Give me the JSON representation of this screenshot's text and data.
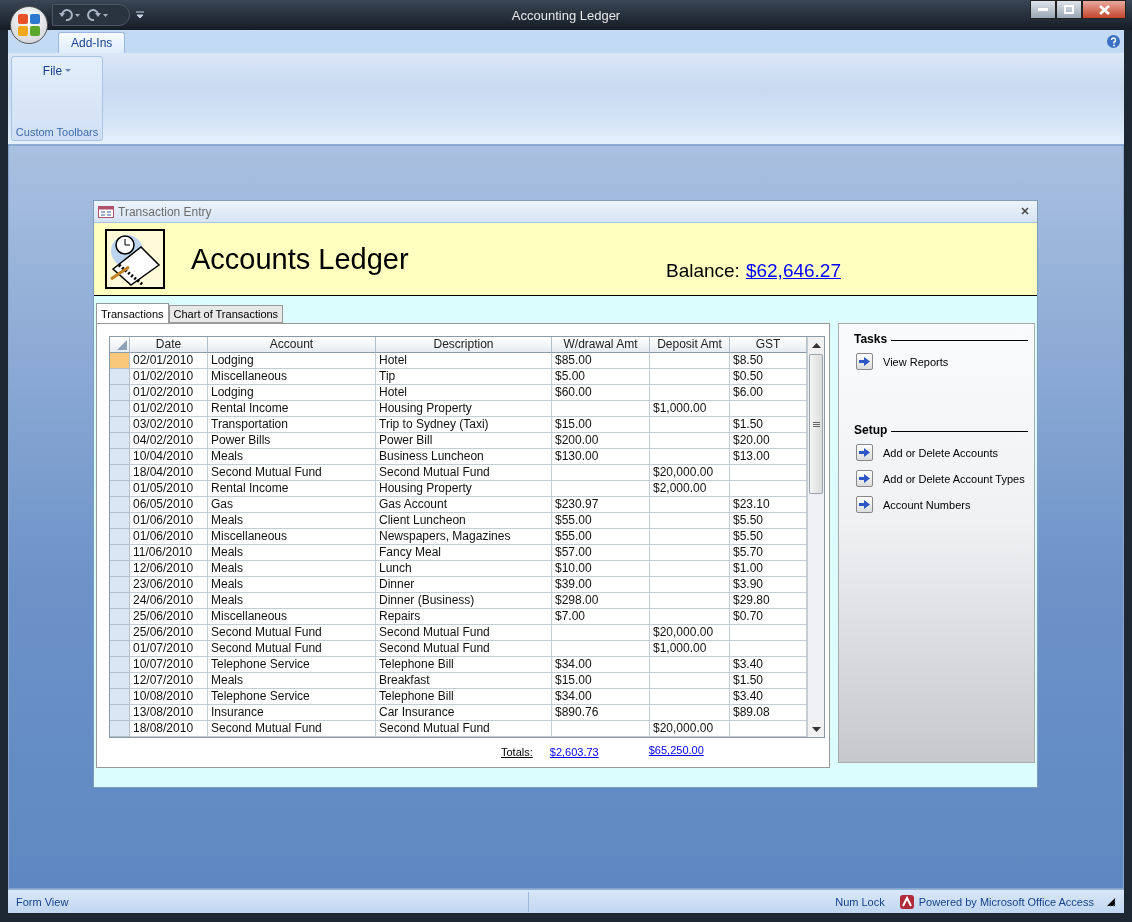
{
  "window": {
    "title": "Accounting Ledger"
  },
  "ribbon": {
    "tabs": [
      {
        "label": "Add-Ins",
        "selected": true
      }
    ],
    "groups": [
      {
        "label": "Custom Toolbars",
        "buttons": [
          "File"
        ]
      }
    ]
  },
  "form": {
    "title": "Transaction Entry",
    "heading": "Accounts Ledger",
    "balance_label": "Balance:",
    "balance_value": "$62,646.27",
    "tabs": [
      {
        "label": "Transactions",
        "selected": true
      },
      {
        "label": "Chart of Transactions",
        "selected": false
      }
    ],
    "table": {
      "columns": [
        "Date",
        "Account",
        "Description",
        "W/drawal Amt",
        "Deposit Amt",
        "GST"
      ],
      "rows": [
        {
          "selected": true,
          "cells": [
            "02/01/2010",
            "Lodging",
            "Hotel",
            "$85.00",
            "",
            "$8.50"
          ]
        },
        {
          "selected": false,
          "cells": [
            "01/02/2010",
            "Miscellaneous",
            "Tip",
            "$5.00",
            "",
            "$0.50"
          ]
        },
        {
          "selected": false,
          "cells": [
            "01/02/2010",
            "Lodging",
            "Hotel",
            "$60.00",
            "",
            "$6.00"
          ]
        },
        {
          "selected": false,
          "cells": [
            "01/02/2010",
            "Rental Income",
            "Housing Property",
            "",
            "$1,000.00",
            ""
          ]
        },
        {
          "selected": false,
          "cells": [
            "03/02/2010",
            "Transportation",
            "Trip to Sydney (Taxi)",
            "$15.00",
            "",
            "$1.50"
          ]
        },
        {
          "selected": false,
          "cells": [
            "04/02/2010",
            "Power Bills",
            "Power Bill",
            "$200.00",
            "",
            "$20.00"
          ]
        },
        {
          "selected": false,
          "cells": [
            "10/04/2010",
            "Meals",
            "Business Luncheon",
            "$130.00",
            "",
            "$13.00"
          ]
        },
        {
          "selected": false,
          "cells": [
            "18/04/2010",
            "Second Mutual Fund",
            "Second Mutual Fund",
            "",
            "$20,000.00",
            ""
          ]
        },
        {
          "selected": false,
          "cells": [
            "01/05/2010",
            "Rental Income",
            "Housing Property",
            "",
            "$2,000.00",
            ""
          ]
        },
        {
          "selected": false,
          "cells": [
            "06/05/2010",
            "Gas",
            "Gas Account",
            "$230.97",
            "",
            "$23.10"
          ]
        },
        {
          "selected": false,
          "cells": [
            "01/06/2010",
            "Meals",
            "Client Luncheon",
            "$55.00",
            "",
            "$5.50"
          ]
        },
        {
          "selected": false,
          "cells": [
            "01/06/2010",
            "Miscellaneous",
            "Newspapers, Magazines",
            "$55.00",
            "",
            "$5.50"
          ]
        },
        {
          "selected": false,
          "cells": [
            "11/06/2010",
            "Meals",
            "Fancy Meal",
            "$57.00",
            "",
            "$5.70"
          ]
        },
        {
          "selected": false,
          "cells": [
            "12/06/2010",
            "Meals",
            "Lunch",
            "$10.00",
            "",
            "$1.00"
          ]
        },
        {
          "selected": false,
          "cells": [
            "23/06/2010",
            "Meals",
            "Dinner",
            "$39.00",
            "",
            "$3.90"
          ]
        },
        {
          "selected": false,
          "cells": [
            "24/06/2010",
            "Meals",
            "Dinner (Business)",
            "$298.00",
            "",
            "$29.80"
          ]
        },
        {
          "selected": false,
          "cells": [
            "25/06/2010",
            "Miscellaneous",
            "Repairs",
            "$7.00",
            "",
            "$0.70"
          ]
        },
        {
          "selected": false,
          "cells": [
            "25/06/2010",
            "Second Mutual Fund",
            "Second Mutual Fund",
            "",
            "$20,000.00",
            ""
          ]
        },
        {
          "selected": false,
          "cells": [
            "01/07/2010",
            "Second Mutual Fund",
            "Second Mutual Fund",
            "",
            "$1,000.00",
            ""
          ]
        },
        {
          "selected": false,
          "cells": [
            "10/07/2010",
            "Telephone Service",
            "Telephone Bill",
            "$34.00",
            "",
            "$3.40"
          ]
        },
        {
          "selected": false,
          "cells": [
            "12/07/2010",
            "Meals",
            "Breakfast",
            "$15.00",
            "",
            "$1.50"
          ]
        },
        {
          "selected": false,
          "cells": [
            "10/08/2010",
            "Telephone Service",
            "Telephone Bill",
            "$34.00",
            "",
            "$3.40"
          ]
        },
        {
          "selected": false,
          "cells": [
            "13/08/2010",
            "Insurance",
            "Car Insurance",
            "$890.76",
            "",
            "$89.08"
          ]
        },
        {
          "selected": false,
          "cells": [
            "18/08/2010",
            "Second Mutual Fund",
            "Second Mutual Fund",
            "",
            "$20,000.00",
            ""
          ]
        }
      ]
    },
    "totals": {
      "label": "Totals:",
      "withdrawal": "$2,603.73",
      "deposit": "$65,250.00"
    },
    "sections": [
      {
        "title": "Tasks",
        "items": [
          "View Reports"
        ]
      },
      {
        "title": "Setup",
        "items": [
          "Add or Delete Accounts",
          "Add or Delete Account Types",
          "Account Numbers"
        ]
      }
    ]
  },
  "status_bar": {
    "view": "Form View",
    "num_lock": "Num Lock",
    "powered": "Powered by Microsoft Office Access"
  }
}
